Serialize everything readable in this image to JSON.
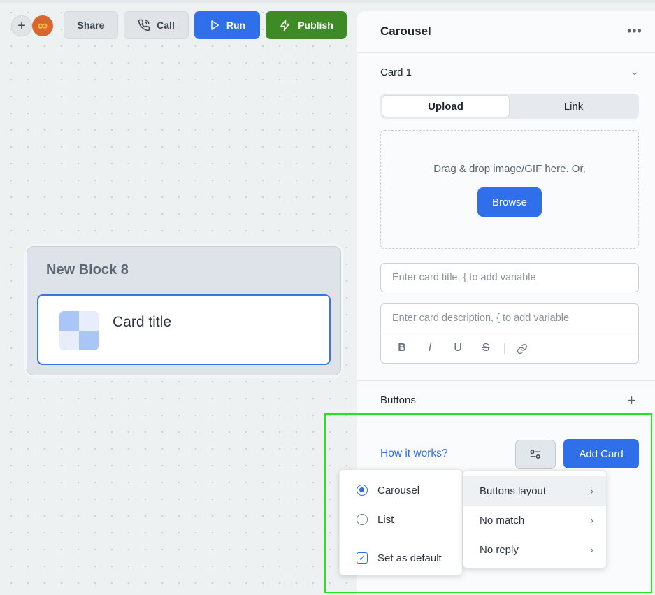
{
  "toolbar": {
    "add_label": "+",
    "share_label": "Share",
    "call_label": "Call",
    "run_label": "Run",
    "publish_label": "Publish"
  },
  "canvas": {
    "block_title": "New Block 8",
    "card_title": "Card title"
  },
  "panel": {
    "title": "Carousel",
    "more_label": "•••",
    "card_section": "Card 1",
    "tabs": [
      "Upload",
      "Link"
    ],
    "drop_text": "Drag & drop image/GIF here. Or,",
    "browse_label": "Browse",
    "title_placeholder": "Enter card title, { to add variable",
    "description_placeholder": "Enter card description, { to add variable",
    "format_buttons": [
      "B",
      "I",
      "U",
      "S"
    ],
    "buttons_label": "Buttons",
    "how_it_works": "How it works?",
    "add_card_label": "Add Card"
  },
  "layout_menu": {
    "options": [
      "Carousel",
      "List"
    ],
    "selected": "Carousel",
    "set_default_label": "Set as default",
    "set_default_checked": true
  },
  "settings_menu": {
    "items": [
      "Buttons layout",
      "No match",
      "No reply"
    ]
  },
  "colors": {
    "primary": "#2f6fe9",
    "publish": "#3e8a25",
    "highlight": "#22e51c"
  }
}
